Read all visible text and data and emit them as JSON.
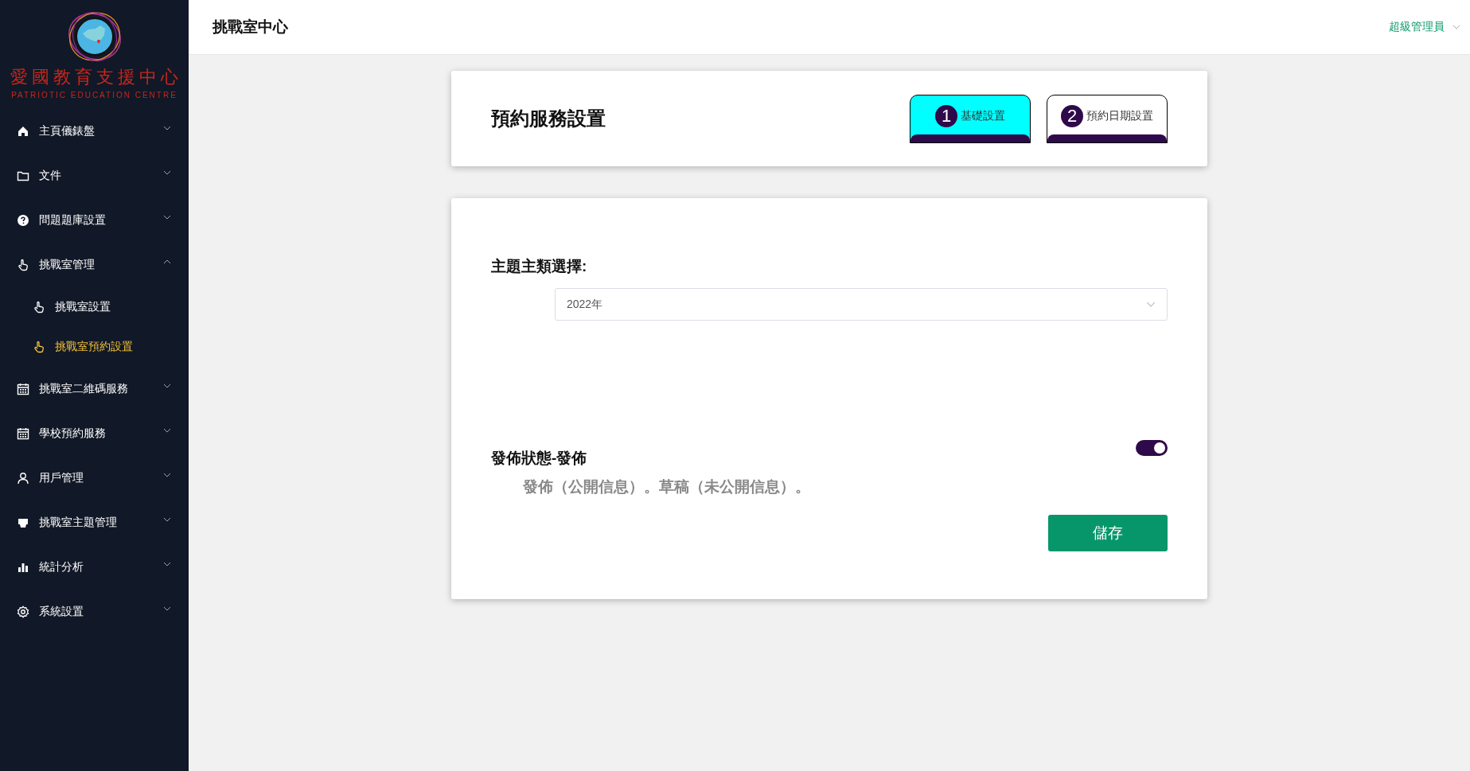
{
  "logo": {
    "title": "愛國教育支援中心",
    "subtitle": "PATRIOTIC EDUCATION CENTRE"
  },
  "nav": [
    {
      "kind": "home",
      "label": "主頁儀錶盤",
      "expanded": false
    },
    {
      "kind": "folder",
      "label": "文件",
      "expanded": false
    },
    {
      "kind": "help",
      "label": "問題題庫設置",
      "expanded": false
    },
    {
      "kind": "hand",
      "label": "挑戰室管理",
      "expanded": true,
      "children": [
        {
          "kind": "hand",
          "label": "挑戰室設置",
          "selected": false
        },
        {
          "kind": "hand",
          "label": "挑戰室預約設置",
          "selected": true
        }
      ]
    },
    {
      "kind": "calendar",
      "label": "挑戰室二維碼服務",
      "expanded": false
    },
    {
      "kind": "calendar",
      "label": "學校預約服務",
      "expanded": false
    },
    {
      "kind": "user",
      "label": "用戶管理",
      "expanded": false
    },
    {
      "kind": "printer",
      "label": "挑戰室主題管理",
      "expanded": false
    },
    {
      "kind": "chart",
      "label": "統計分析",
      "expanded": false
    },
    {
      "kind": "gear",
      "label": "系統設置",
      "expanded": false
    }
  ],
  "header": {
    "title": "挑戰室中心",
    "user": "超級管理員"
  },
  "settings": {
    "title": "預約服務設置",
    "steps": [
      {
        "number": "1",
        "label": "基礎設置",
        "selected": true
      },
      {
        "number": "2",
        "label": "預約日期設置",
        "selected": false
      }
    ]
  },
  "form": {
    "category_label": "主題主類選擇:",
    "category_value": "2022年",
    "publish_label": "發佈狀態-發佈",
    "publish_on": true,
    "publish_hint": "發佈（公開信息）。草稿（未公開信息）。",
    "save_button": "儲存"
  }
}
